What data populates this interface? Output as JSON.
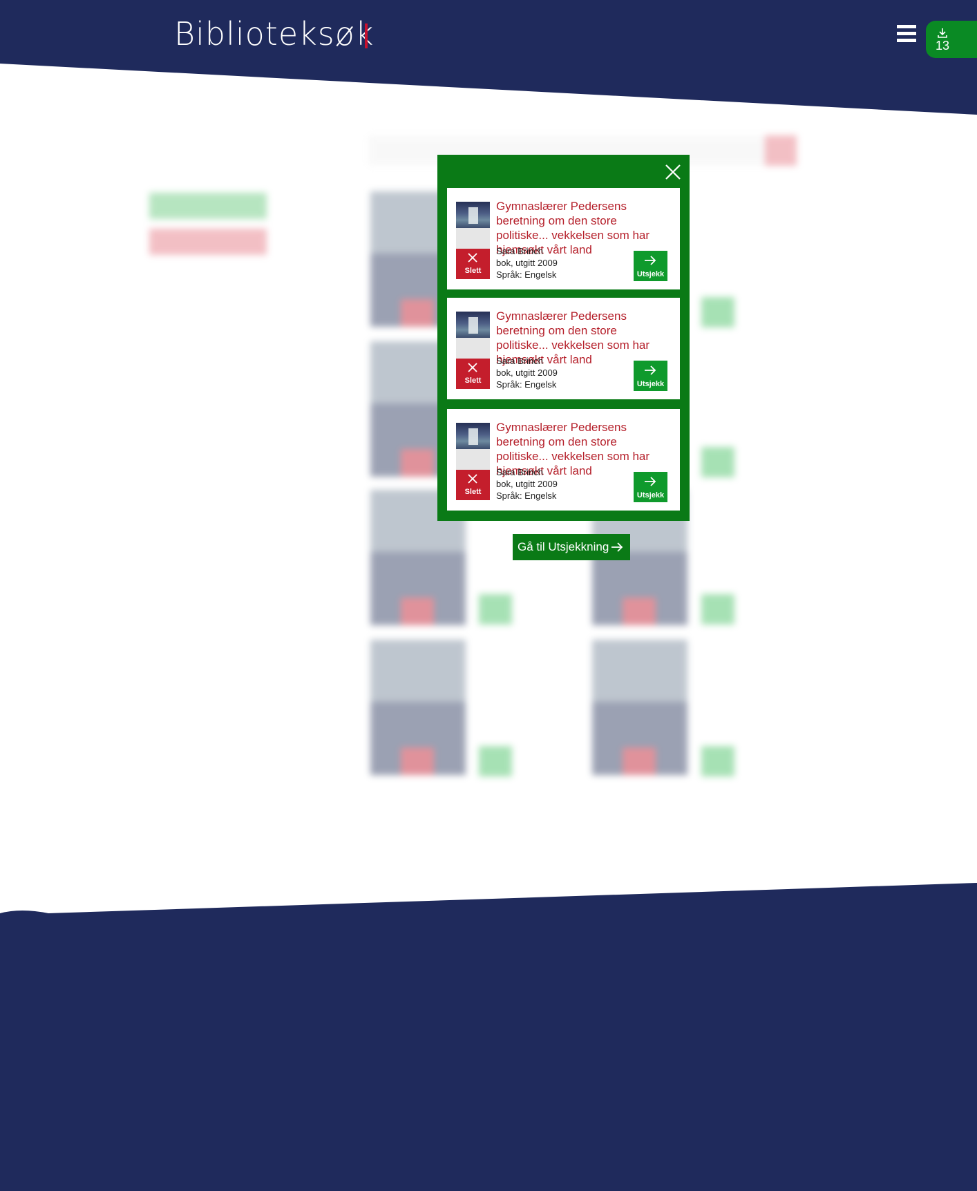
{
  "header": {
    "brand": "Biblioteksøk",
    "menu_icon": "hamburger-menu-icon",
    "picklist_icon": "download-icon",
    "picklist_count": "13"
  },
  "colors": {
    "navy": "#1f2a5c",
    "green": "#0a7a16",
    "button_green": "#0f9a2c",
    "red": "#c41e2c",
    "title_red": "#b51f2a"
  },
  "modal": {
    "close_icon": "close-icon",
    "items": [
      {
        "title": "Gymnaslærer Pedersens beretning om den store politiske... vekkelsen som har hjemsøkt vårt land",
        "author": "Sara Brinch",
        "type": "bok, utgitt 2009",
        "language": "Språk: Engelsk",
        "delete_label": "Slett",
        "checkout_label": "Utsjekk"
      },
      {
        "title": "Gymnaslærer Pedersens beretning om den store politiske... vekkelsen som har hjemsøkt vårt land",
        "author": "Sara Brinch",
        "type": "bok, utgitt 2009",
        "language": "Språk: Engelsk",
        "delete_label": "Slett",
        "checkout_label": "Utsjekk"
      },
      {
        "title": "Gymnaslærer Pedersens beretning om den store politiske... vekkelsen som har hjemsøkt vårt land",
        "author": "Sara Brinch",
        "type": "bok, utgitt 2009",
        "language": "Språk: Engelsk",
        "delete_label": "Slett",
        "checkout_label": "Utsjekk"
      }
    ],
    "goto_label": "Gå til Utsjekkning"
  }
}
